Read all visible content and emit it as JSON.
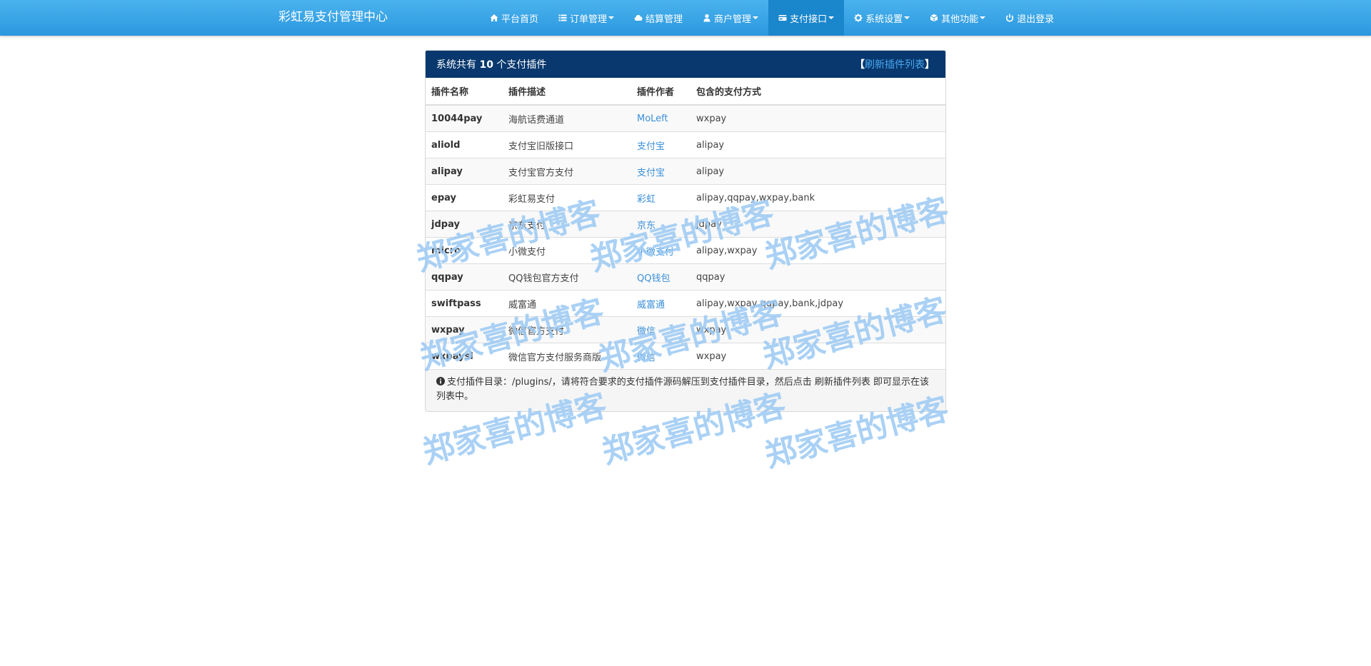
{
  "brand": "彩虹易支付管理中心",
  "nav": [
    {
      "label": "平台首页",
      "icon": "home-icon",
      "dropdown": false,
      "active": false
    },
    {
      "label": "订单管理",
      "icon": "list-icon",
      "dropdown": true,
      "active": false
    },
    {
      "label": "结算管理",
      "icon": "cloud-icon",
      "dropdown": false,
      "active": false
    },
    {
      "label": "商户管理",
      "icon": "user-icon",
      "dropdown": true,
      "active": false
    },
    {
      "label": "支付接口",
      "icon": "credit-card-icon",
      "dropdown": true,
      "active": true
    },
    {
      "label": "系统设置",
      "icon": "gear-icon",
      "dropdown": true,
      "active": false
    },
    {
      "label": "其他功能",
      "icon": "cube-icon",
      "dropdown": true,
      "active": false
    },
    {
      "label": "退出登录",
      "icon": "power-icon",
      "dropdown": false,
      "active": false
    }
  ],
  "panel": {
    "title_prefix": "系统共有",
    "plugin_count": "10",
    "title_suffix": "个支付插件",
    "bracket_open": "【",
    "refresh_label": "刷新插件列表",
    "bracket_close": "】"
  },
  "table": {
    "headers": [
      "插件名称",
      "插件描述",
      "插件作者",
      "包含的支付方式"
    ],
    "rows": [
      {
        "name": "10044pay",
        "desc": "海航话费通道",
        "author": "MoLeft",
        "methods": "wxpay"
      },
      {
        "name": "aliold",
        "desc": "支付宝旧版接口",
        "author": "支付宝",
        "methods": "alipay"
      },
      {
        "name": "alipay",
        "desc": "支付宝官方支付",
        "author": "支付宝",
        "methods": "alipay"
      },
      {
        "name": "epay",
        "desc": "彩虹易支付",
        "author": "彩虹",
        "methods": "alipay,qqpay,wxpay,bank"
      },
      {
        "name": "jdpay",
        "desc": "京东支付",
        "author": "京东",
        "methods": "jdpay"
      },
      {
        "name": "micro",
        "desc": "小微支付",
        "author": "小微支付",
        "methods": "alipay,wxpay"
      },
      {
        "name": "qqpay",
        "desc": "QQ钱包官方支付",
        "author": "QQ钱包",
        "methods": "qqpay"
      },
      {
        "name": "swiftpass",
        "desc": "威富通",
        "author": "威富通",
        "methods": "alipay,wxpay,qqpay,bank,jdpay"
      },
      {
        "name": "wxpay",
        "desc": "微信官方支付",
        "author": "微信",
        "methods": "wxpay"
      },
      {
        "name": "wxpaysl",
        "desc": "微信官方支付服务商版",
        "author": "微信",
        "methods": "wxpay"
      }
    ]
  },
  "footer_note": "支付插件目录：/plugins/，请将符合要求的支付插件源码解压到支付插件目录，然后点击 刷新插件列表 即可显示在该列表中。",
  "watermark": "郑家喜的博客",
  "colors": {
    "navbar": "#2b98de",
    "panel_heading": "#08386e",
    "link": "#3a8fd9",
    "watermark": "#9ccaf4"
  }
}
